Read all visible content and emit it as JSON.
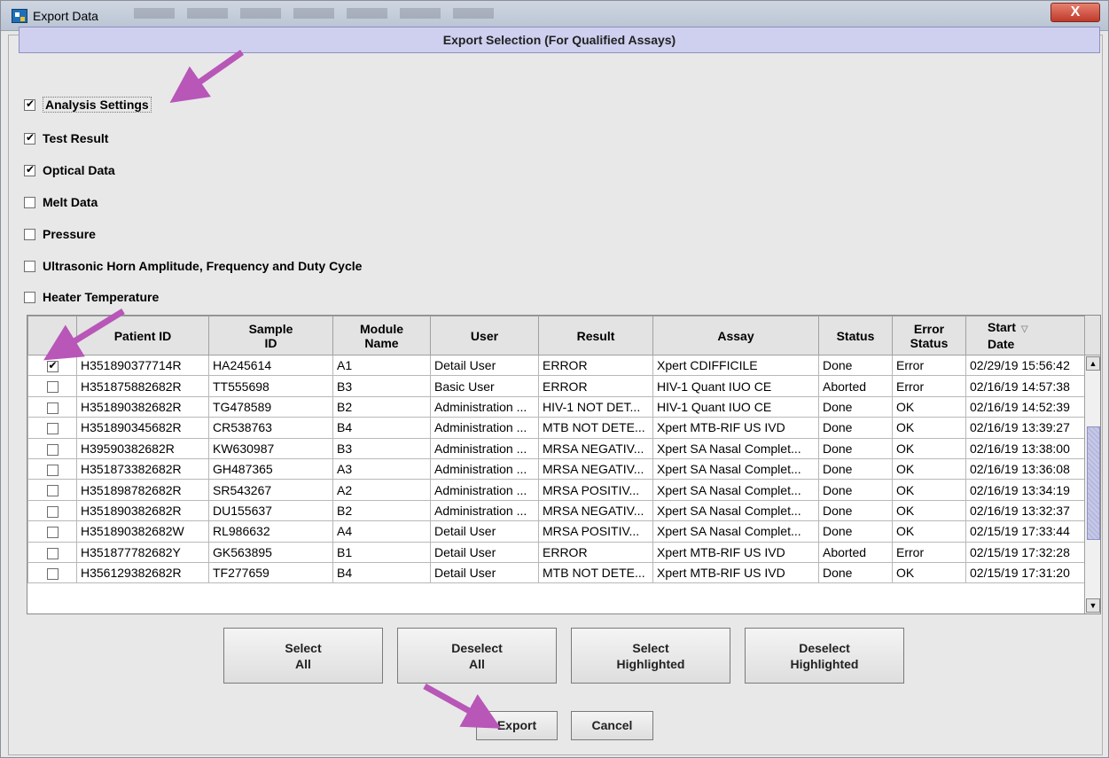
{
  "window": {
    "title": "Export Data",
    "close_label": "X"
  },
  "section_header": "Export Selection (For Qualified Assays)",
  "options": [
    {
      "label": "Analysis Settings",
      "checked": true
    },
    {
      "label": "Test Result",
      "checked": true
    },
    {
      "label": "Optical Data",
      "checked": true
    },
    {
      "label": "Melt Data",
      "checked": false
    },
    {
      "label": "Pressure",
      "checked": false
    },
    {
      "label": "Ultrasonic Horn Amplitude, Frequency and Duty Cycle",
      "checked": false
    },
    {
      "label": "Heater Temperature",
      "checked": false
    }
  ],
  "table": {
    "headers": {
      "patient_id": "Patient ID",
      "sample_id_1": "Sample",
      "sample_id_2": "ID",
      "module_1": "Module",
      "module_2": "Name",
      "user": "User",
      "result": "Result",
      "assay": "Assay",
      "status": "Status",
      "error_1": "Error",
      "error_2": "Status",
      "start_1": "Start",
      "start_2": "Date"
    },
    "sort_icon": "sort-descending-icon",
    "rows": [
      {
        "checked": true,
        "patient_id": "H351890377714R",
        "sample_id": "HA245614",
        "module": "A1",
        "user": "Detail User",
        "result": "ERROR",
        "assay": "Xpert CDIFFICILE",
        "status": "Done",
        "error_status": "Error",
        "start_date": "02/29/19 15:56:42"
      },
      {
        "checked": false,
        "patient_id": "H351875882682R",
        "sample_id": "TT555698",
        "module": "B3",
        "user": "Basic User",
        "result": "ERROR",
        "assay": "HIV-1 Quant IUO CE",
        "status": "Aborted",
        "error_status": "Error",
        "start_date": "02/16/19 14:57:38"
      },
      {
        "checked": false,
        "patient_id": "H351890382682R",
        "sample_id": "TG478589",
        "module": "B2",
        "user": "Administration ...",
        "result": "HIV-1 NOT DET...",
        "assay": "HIV-1 Quant IUO CE",
        "status": "Done",
        "error_status": "OK",
        "start_date": "02/16/19 14:52:39"
      },
      {
        "checked": false,
        "patient_id": "H351890345682R",
        "sample_id": "CR538763",
        "module": "B4",
        "user": "Administration ...",
        "result": "MTB NOT DETE...",
        "assay": "Xpert MTB-RIF US IVD",
        "status": "Done",
        "error_status": "OK",
        "start_date": "02/16/19 13:39:27"
      },
      {
        "checked": false,
        "patient_id": "H39590382682R",
        "sample_id": "KW630987",
        "module": "B3",
        "user": "Administration ...",
        "result": "MRSA NEGATIV...",
        "assay": "Xpert SA Nasal Complet...",
        "status": "Done",
        "error_status": "OK",
        "start_date": "02/16/19 13:38:00"
      },
      {
        "checked": false,
        "patient_id": "H351873382682R",
        "sample_id": "GH487365",
        "module": "A3",
        "user": "Administration ...",
        "result": "MRSA NEGATIV...",
        "assay": "Xpert SA Nasal Complet...",
        "status": "Done",
        "error_status": "OK",
        "start_date": "02/16/19 13:36:08"
      },
      {
        "checked": false,
        "patient_id": "H351898782682R",
        "sample_id": "SR543267",
        "module": "A2",
        "user": "Administration ...",
        "result": "MRSA POSITIV...",
        "assay": "Xpert SA Nasal Complet...",
        "status": "Done",
        "error_status": "OK",
        "start_date": "02/16/19 13:34:19"
      },
      {
        "checked": false,
        "patient_id": "H351890382682R",
        "sample_id": "DU155637",
        "module": "B2",
        "user": "Administration ...",
        "result": "MRSA NEGATIV...",
        "assay": "Xpert SA Nasal Complet...",
        "status": "Done",
        "error_status": "OK",
        "start_date": "02/16/19 13:32:37"
      },
      {
        "checked": false,
        "patient_id": "H351890382682W",
        "sample_id": "RL986632",
        "module": "A4",
        "user": "Detail User",
        "result": "MRSA POSITIV...",
        "assay": "Xpert SA Nasal Complet...",
        "status": "Done",
        "error_status": "OK",
        "start_date": "02/15/19 17:33:44"
      },
      {
        "checked": false,
        "patient_id": "H351877782682Y",
        "sample_id": "GK563895",
        "module": "B1",
        "user": "Detail User",
        "result": "ERROR",
        "assay": "Xpert MTB-RIF US IVD",
        "status": "Aborted",
        "error_status": "Error",
        "start_date": "02/15/19 17:32:28"
      },
      {
        "checked": false,
        "patient_id": "H356129382682R",
        "sample_id": "TF277659",
        "module": "B4",
        "user": "Detail User",
        "result": "MTB NOT DETE...",
        "assay": "Xpert MTB-RIF US IVD",
        "status": "Done",
        "error_status": "OK",
        "start_date": "02/15/19 17:31:20"
      }
    ]
  },
  "buttons": {
    "select_all_1": "Select",
    "select_all_2": "All",
    "deselect_all_1": "Deselect",
    "deselect_all_2": "All",
    "select_highlighted_1": "Select",
    "select_highlighted_2": "Highlighted",
    "deselect_highlighted_1": "Deselect",
    "deselect_highlighted_2": "Highlighted",
    "export": "Export",
    "cancel": "Cancel"
  },
  "annotation_color": "#b857b8"
}
